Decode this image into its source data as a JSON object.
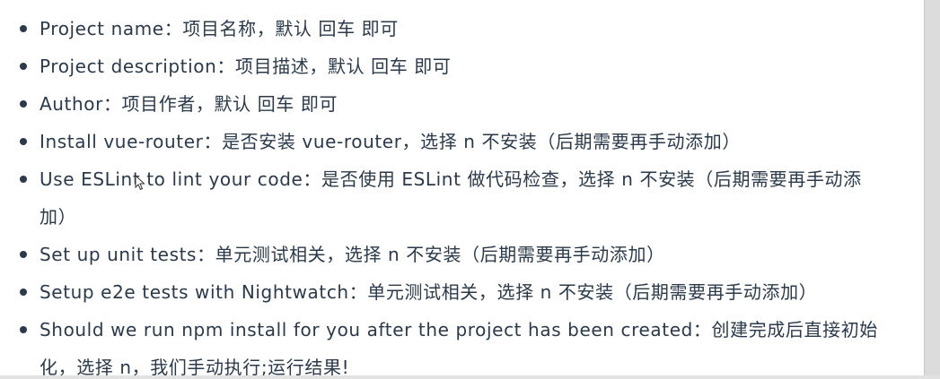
{
  "items": [
    {
      "term": "Project name",
      "desc": "：项目名称，默认 回车 即可"
    },
    {
      "term": "Project description",
      "desc": "：项目描述，默认 回车 即可"
    },
    {
      "term": "Author",
      "desc": "：项目作者，默认 回车 即可"
    },
    {
      "term": "Install vue-router",
      "desc": "：是否安装 vue-router，选择 n 不安装（后期需要再手动添加）"
    },
    {
      "term": "Use ESLint to lint your code",
      "desc": "：是否使用 ESLint 做代码检查，选择 n 不安装（后期需要再手动添加）"
    },
    {
      "term": "Set up unit tests",
      "desc": "：单元测试相关，选择 n 不安装（后期需要再手动添加）"
    },
    {
      "term": "Setup e2e tests with Nightwatch",
      "desc": "：单元测试相关，选择 n 不安装（后期需要再手动添加）"
    },
    {
      "term": "Should we run npm install for you after the project has been created",
      "desc": "：创建完成后直接初始化，选择 n，我们手动执行;运行结果!"
    }
  ],
  "cursor_icon": "arrow-pointer-icon"
}
